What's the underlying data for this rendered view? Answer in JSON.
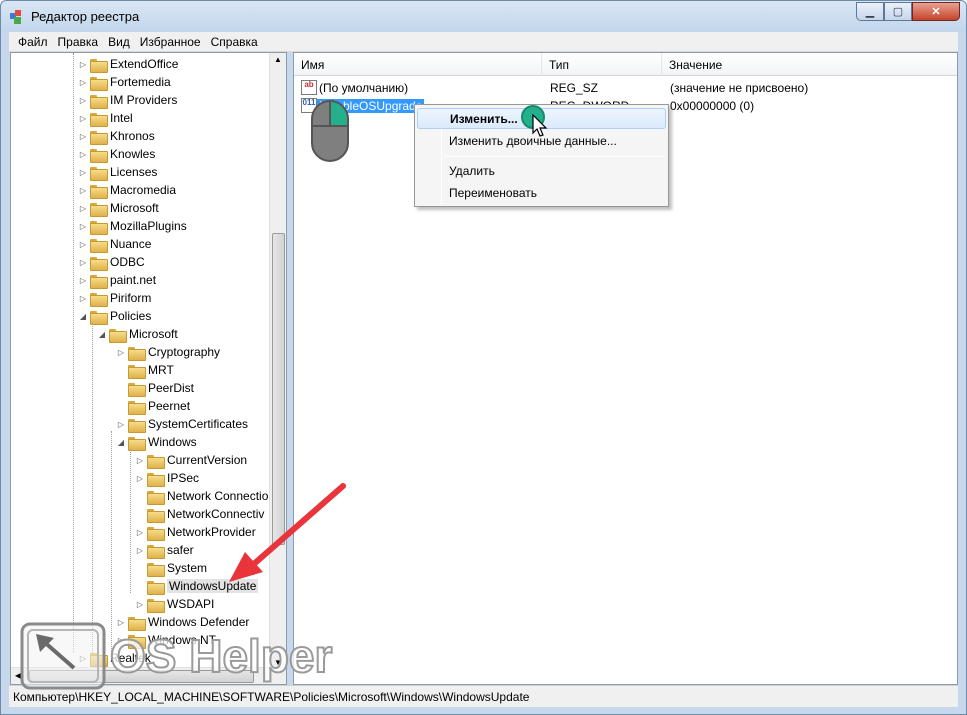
{
  "window": {
    "title": "Редактор реестра",
    "buttons": [
      "0",
      "1",
      "r"
    ]
  },
  "menu": [
    "Файл",
    "Правка",
    "Вид",
    "Избранное",
    "Справка"
  ],
  "tree": {
    "items": [
      {
        "label": "ExtendOffice",
        "level": 0,
        "expander": "▷"
      },
      {
        "label": "Fortemedia",
        "level": 0,
        "expander": "▷"
      },
      {
        "label": "IM Providers",
        "level": 0,
        "expander": "▷"
      },
      {
        "label": "Intel",
        "level": 0,
        "expander": "▷"
      },
      {
        "label": "Khronos",
        "level": 0,
        "expander": "▷"
      },
      {
        "label": "Knowles",
        "level": 0,
        "expander": "▷"
      },
      {
        "label": "Licenses",
        "level": 0,
        "expander": "▷"
      },
      {
        "label": "Macromedia",
        "level": 0,
        "expander": "▷"
      },
      {
        "label": "Microsoft",
        "level": 0,
        "expander": "▷"
      },
      {
        "label": "MozillaPlugins",
        "level": 0,
        "expander": "▷"
      },
      {
        "label": "Nuance",
        "level": 0,
        "expander": "▷"
      },
      {
        "label": "ODBC",
        "level": 0,
        "expander": "▷"
      },
      {
        "label": "paint.net",
        "level": 0,
        "expander": "▷"
      },
      {
        "label": "Piriform",
        "level": 0,
        "expander": "▷"
      },
      {
        "label": "Policies",
        "level": 0,
        "expander": "◢"
      },
      {
        "label": "Microsoft",
        "level": 1,
        "expander": "◢"
      },
      {
        "label": "Cryptography",
        "level": 2,
        "expander": "▷"
      },
      {
        "label": "MRT",
        "level": 2,
        "expander": ""
      },
      {
        "label": "PeerDist",
        "level": 2,
        "expander": ""
      },
      {
        "label": "Peernet",
        "level": 2,
        "expander": ""
      },
      {
        "label": "SystemCertificates",
        "level": 2,
        "expander": "▷"
      },
      {
        "label": "Windows",
        "level": 2,
        "expander": "◢"
      },
      {
        "label": "CurrentVersion",
        "level": 3,
        "expander": "▷"
      },
      {
        "label": "IPSec",
        "level": 3,
        "expander": "▷"
      },
      {
        "label": "Network Connectio",
        "level": 3,
        "expander": ""
      },
      {
        "label": "NetworkConnectiv",
        "level": 3,
        "expander": ""
      },
      {
        "label": "NetworkProvider",
        "level": 3,
        "expander": "▷"
      },
      {
        "label": "safer",
        "level": 3,
        "expander": "▷"
      },
      {
        "label": "System",
        "level": 3,
        "expander": ""
      },
      {
        "label": "WindowsUpdate",
        "level": 3,
        "expander": ""
      },
      {
        "label": "WSDAPI",
        "level": 3,
        "expander": "▷"
      },
      {
        "label": "Windows Defender",
        "level": 2,
        "expander": "▷"
      },
      {
        "label": "Windows NT",
        "level": 2,
        "expander": "▷"
      },
      {
        "label": "Realtek",
        "level": 0,
        "expander": "▷"
      }
    ]
  },
  "list": {
    "columns": [
      "Имя",
      "Тип",
      "Значение"
    ],
    "rows": [
      {
        "icon": "ab",
        "name": "(По умолчанию)",
        "type": "REG_SZ",
        "value": "(значение не присвоено)"
      },
      {
        "icon": "011",
        "name": "DisableOSUpgrade",
        "type": "REG_DWORD",
        "value": "0x00000000 (0)"
      }
    ]
  },
  "context_menu": {
    "items": [
      "Изменить...",
      "Изменить двоичные данные...",
      "Удалить",
      "Переименовать"
    ]
  },
  "status": "Компьютер\\HKEY_LOCAL_MACHINE\\SOFTWARE\\Policies\\Microsoft\\Windows\\WindowsUpdate",
  "watermark": "OS Helper",
  "colors": {
    "selection": "#3399ff",
    "arrow": "#e8343a",
    "mouse_accent": "#23b08a"
  }
}
